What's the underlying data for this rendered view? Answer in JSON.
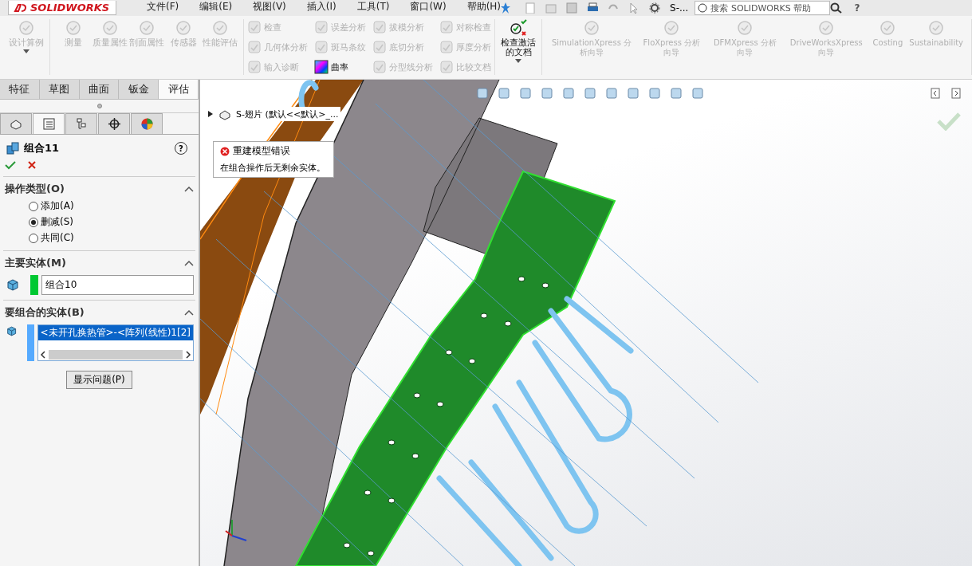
{
  "app": {
    "logo": "SOLIDWORKS",
    "menu": [
      "文件(F)",
      "编辑(E)",
      "视图(V)",
      "插入(I)",
      "工具(T)",
      "窗口(W)",
      "帮助(H)"
    ],
    "document": "S-...",
    "search": {
      "placeholder": "搜索 SOLIDWORKS 帮助"
    },
    "help": "?"
  },
  "ribbon": {
    "groups": [
      {
        "kind": "large",
        "items": [
          {
            "label": "设计算例",
            "disabled": true,
            "dropdown": true
          }
        ]
      },
      {
        "kind": "large",
        "items": [
          {
            "label": "测量",
            "disabled": true
          },
          {
            "label": "质量属性",
            "disabled": true
          },
          {
            "label": "剖面属性",
            "disabled": true
          },
          {
            "label": "传感器",
            "disabled": true
          },
          {
            "label": "性能评估",
            "disabled": true
          }
        ]
      },
      {
        "kind": "small",
        "items": [
          {
            "label": "检查",
            "disabled": true
          },
          {
            "label": "几何体分析",
            "disabled": true
          },
          {
            "label": "输入诊断",
            "disabled": true
          }
        ]
      },
      {
        "kind": "small",
        "items": [
          {
            "label": "误差分析",
            "disabled": true
          },
          {
            "label": "斑马条纹",
            "disabled": true
          },
          {
            "label": "曲率",
            "disabled": false
          }
        ]
      },
      {
        "kind": "small",
        "items": [
          {
            "label": "拔模分析",
            "disabled": true
          },
          {
            "label": "底切分析",
            "disabled": true
          },
          {
            "label": "分型线分析",
            "disabled": true
          }
        ]
      },
      {
        "kind": "small",
        "items": [
          {
            "label": "对称检查",
            "disabled": true
          },
          {
            "label": "厚度分析",
            "disabled": true
          },
          {
            "label": "比较文档",
            "disabled": true
          }
        ]
      },
      {
        "kind": "large",
        "items": [
          {
            "label": "检查激活的文档",
            "disabled": false,
            "dropdown": true
          }
        ]
      },
      {
        "kind": "large",
        "items": [
          {
            "label": "SimulationXpress 分析向导",
            "disabled": true
          },
          {
            "label": "FloXpress 分析向导",
            "disabled": true
          },
          {
            "label": "DFMXpress 分析向导",
            "disabled": true
          },
          {
            "label": "DriveWorksXpress 向导",
            "disabled": true
          },
          {
            "label": "Costing",
            "disabled": true
          },
          {
            "label": "Sustainability",
            "disabled": true
          }
        ]
      }
    ]
  },
  "tabs": [
    {
      "label": "特征",
      "selected": false
    },
    {
      "label": "草图",
      "selected": false
    },
    {
      "label": "曲面",
      "selected": false
    },
    {
      "label": "钣金",
      "selected": false
    },
    {
      "label": "评估",
      "selected": true
    }
  ],
  "panel_tabs": [
    {
      "kind": "feature",
      "selected": false
    },
    {
      "kind": "property",
      "selected": true
    },
    {
      "kind": "config",
      "selected": false
    },
    {
      "kind": "dim",
      "selected": false
    },
    {
      "kind": "display",
      "selected": false
    }
  ],
  "property_manager": {
    "title": "组合11",
    "help": "?",
    "sections": [
      {
        "kind": "radio",
        "title": "操作类型(O)",
        "expanded": true,
        "options": [
          {
            "label": "添加(A)",
            "selected": false
          },
          {
            "label": "删减(S)",
            "selected": true
          },
          {
            "label": "共同(C)",
            "selected": false
          }
        ]
      },
      {
        "kind": "field",
        "title": "主要实体(M)",
        "expanded": true,
        "value": "组合10",
        "color": "#00c832"
      },
      {
        "kind": "list",
        "title": "要组合的实体(B)",
        "expanded": true,
        "color": "#55aaff",
        "items": [
          {
            "label": "<未开孔换热管>-<阵列(线性)1[2]",
            "selected": true
          }
        ]
      }
    ],
    "button": "显示问题(P)"
  },
  "viewport": {
    "tree_item": "S-翅片  (默认<<默认>_...",
    "error": {
      "title": "重建模型错误",
      "message": "在组合操作后无剩余实体。"
    }
  }
}
